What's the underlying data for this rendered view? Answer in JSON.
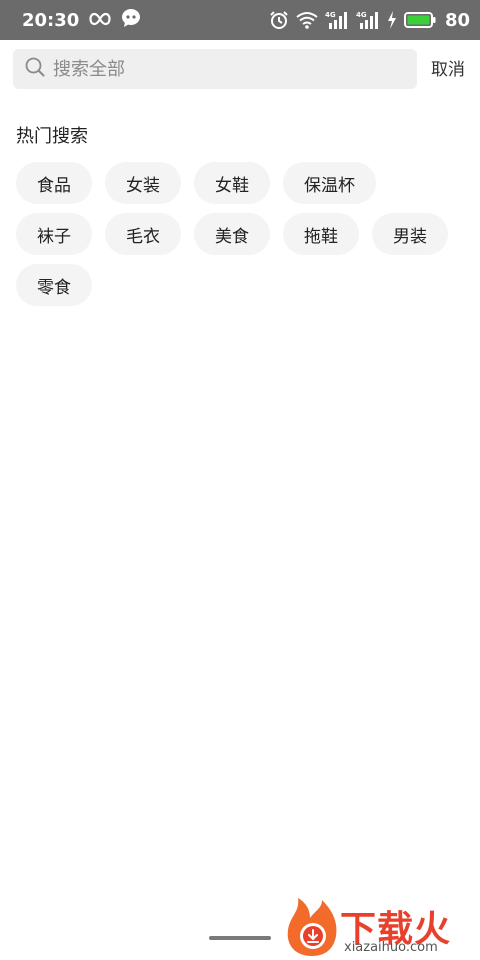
{
  "status_bar": {
    "time": "20:30",
    "network_label": "4G",
    "battery": "80"
  },
  "search": {
    "placeholder": "搜索全部",
    "cancel_label": "取消"
  },
  "hot_search": {
    "title": "热门搜索",
    "tags": [
      "食品",
      "女装",
      "女鞋",
      "保温杯",
      "袜子",
      "毛衣",
      "美食",
      "拖鞋",
      "男装",
      "零食"
    ]
  },
  "watermark": {
    "brand": "下载火",
    "site": "xiazaihuo.com"
  },
  "colors": {
    "status_bar_bg": "#6b6b6b",
    "search_box_bg": "#efefef",
    "tag_bg": "#f4f4f4",
    "battery_fill": "#3ccf3c",
    "watermark": "#e8402b"
  }
}
